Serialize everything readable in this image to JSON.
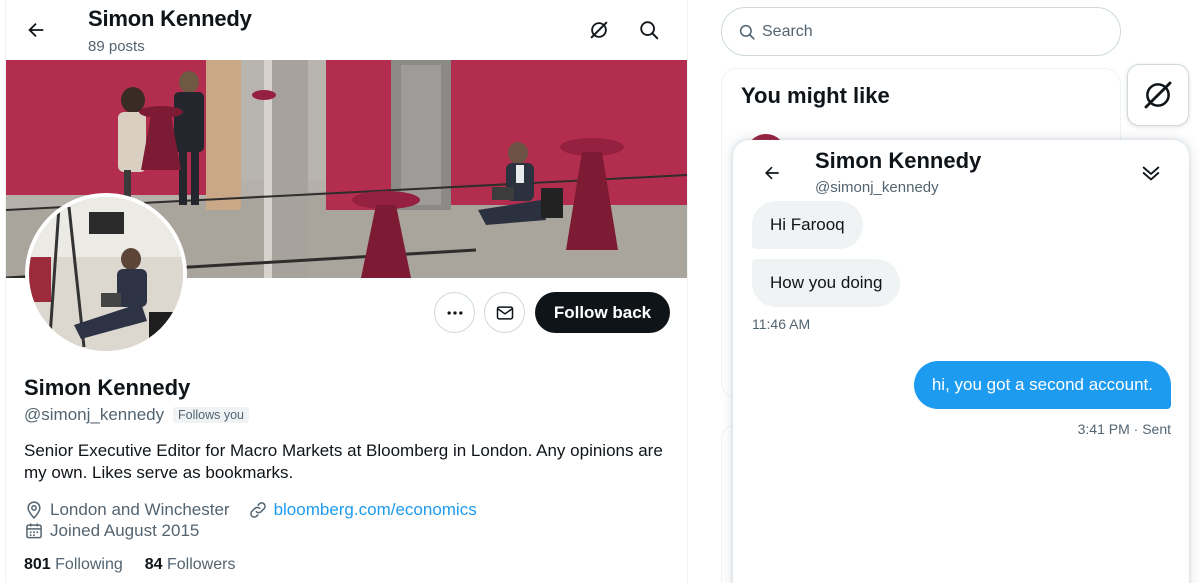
{
  "header": {
    "name": "Simon Kennedy",
    "posts": "89 posts",
    "icons": [
      "back-arrow-icon",
      "grok-icon",
      "search-icon"
    ]
  },
  "profile": {
    "name": "Simon Kennedy",
    "handle": "@simonj_kennedy",
    "follows_you": "Follows you",
    "bio": "Senior Executive Editor for Macro Markets at Bloomberg in London. Any opinions are my own. Likes serve as bookmarks.",
    "location": "London and Winchester",
    "website": "bloomberg.com/economics",
    "joined": "Joined August 2015",
    "following_count": "801",
    "following_label": "Following",
    "followers_count": "84",
    "followers_label": "Followers",
    "follow_button": "Follow back"
  },
  "sidebar": {
    "search_placeholder": "Search",
    "you_might_like": "You might like"
  },
  "dm": {
    "name": "Simon Kennedy",
    "handle": "@simonj_kennedy",
    "incoming": [
      "Hi Farooq",
      "How you doing"
    ],
    "incoming_time": "11:46 AM",
    "outgoing": "hi, you got a second account.",
    "outgoing_status": "3:41 PM · Sent"
  },
  "colors": {
    "accent": "#1d9bf0",
    "text": "#0f1419",
    "muted": "#536471",
    "follow_button": "#0f1419"
  }
}
